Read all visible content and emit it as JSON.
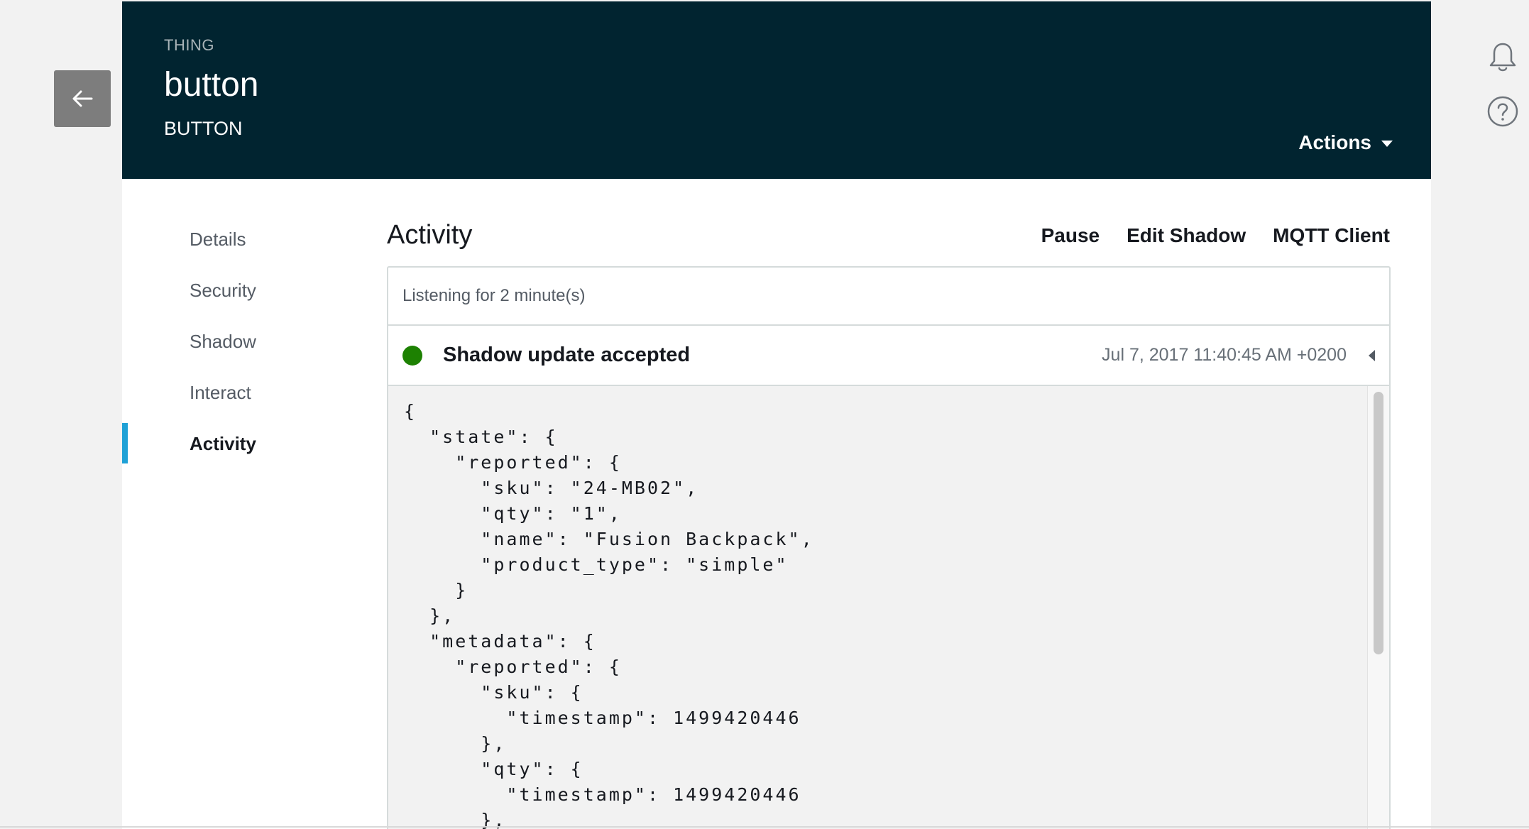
{
  "header": {
    "kicker": "THING",
    "title": "button",
    "subtitle": "BUTTON",
    "actions_label": "Actions",
    "background_color": "#012430"
  },
  "icons": {
    "back": "arrow-left-icon",
    "notifications": "bell-icon",
    "help": "help-icon",
    "actions_caret": "chevron-down-icon",
    "event_caret": "caret-left-icon"
  },
  "sidebar": {
    "items": [
      {
        "label": "Details"
      },
      {
        "label": "Security"
      },
      {
        "label": "Shadow"
      },
      {
        "label": "Interact"
      },
      {
        "label": "Activity"
      }
    ],
    "active_item": "Activity",
    "accent_color": "#1fa1d6"
  },
  "activity": {
    "title": "Activity",
    "actions": {
      "pause": "Pause",
      "edit_shadow": "Edit Shadow",
      "mqtt_client": "MQTT Client"
    },
    "listening_text": "Listening for 2 minute(s)",
    "event": {
      "title": "Shadow update accepted",
      "timestamp": "Jul 7, 2017 11:40:45 AM +0200",
      "status_color": "#1d8102"
    },
    "payload_lines": [
      "{",
      "  \"state\": {",
      "    \"reported\": {",
      "      \"sku\": \"24-MB02\",",
      "      \"qty\": \"1\",",
      "      \"name\": \"Fusion Backpack\",",
      "      \"product_type\": \"simple\"",
      "    }",
      "  },",
      "  \"metadata\": {",
      "    \"reported\": {",
      "      \"sku\": {",
      "        \"timestamp\": 1499420446",
      "      },",
      "      \"qty\": {",
      "        \"timestamp\": 1499420446",
      "      },"
    ]
  }
}
